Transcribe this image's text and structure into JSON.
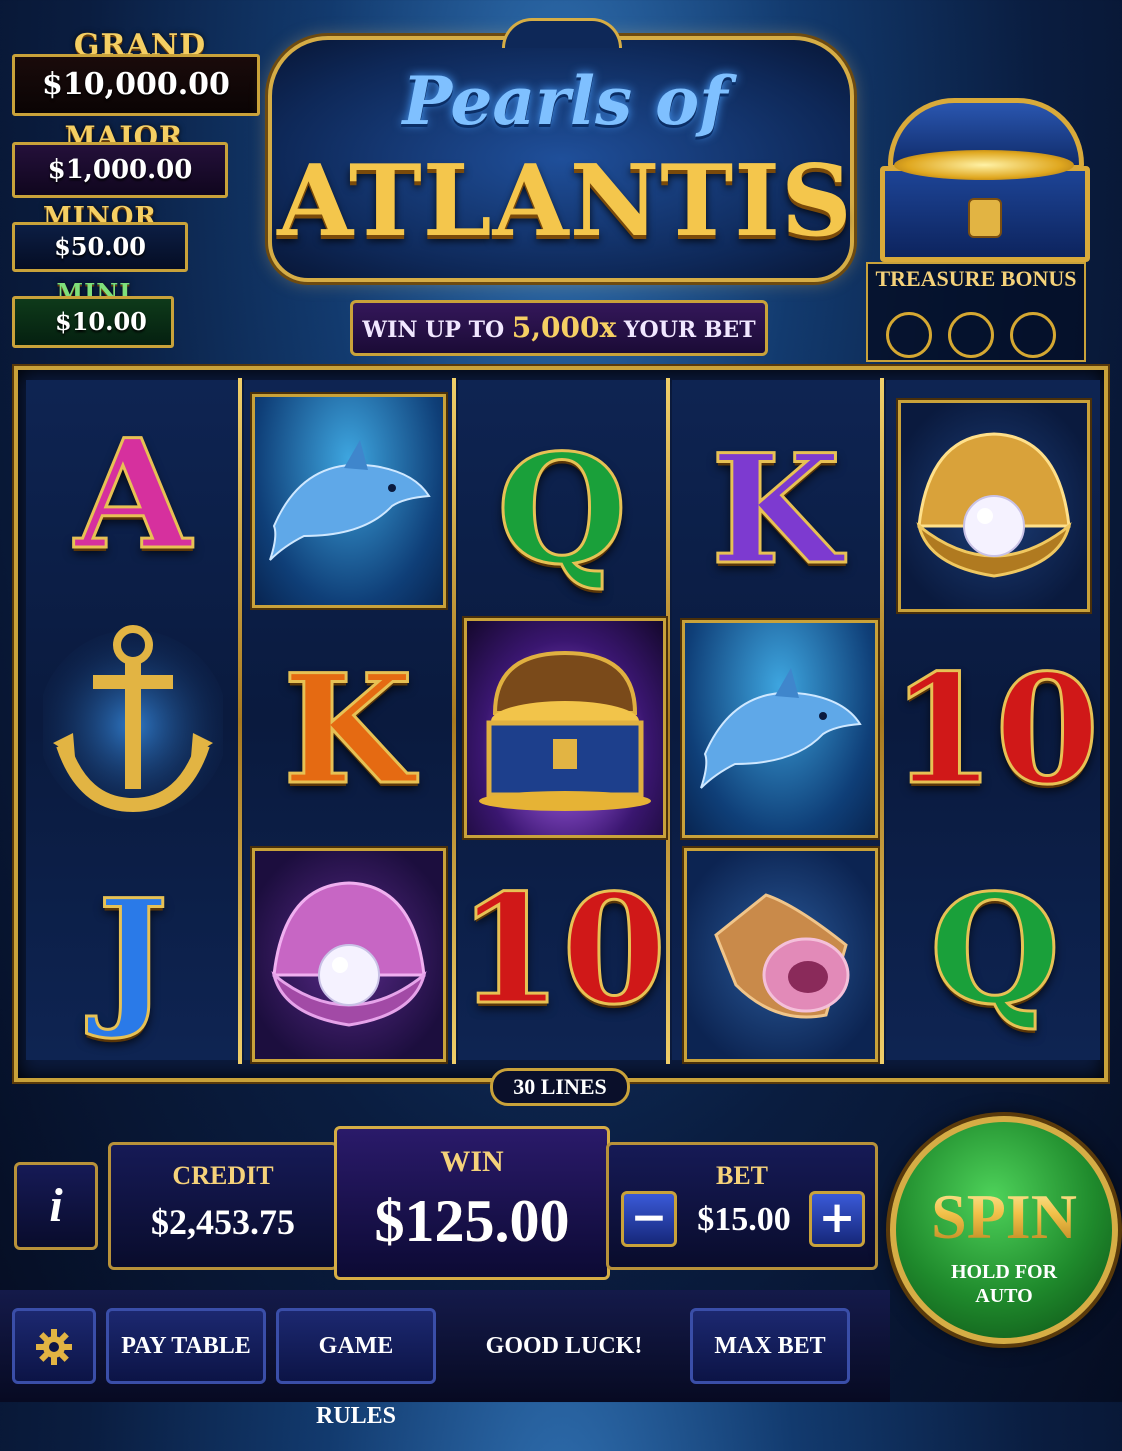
{
  "jackpots": [
    {
      "label": "GRAND",
      "value": "$10,000.00"
    },
    {
      "label": "MAJOR",
      "value": "$1,000.00"
    },
    {
      "label": "MINOR",
      "value": "$50.00"
    },
    {
      "label": "MINI",
      "value": "$10.00"
    }
  ],
  "title": {
    "line1": "Pearls of",
    "line2": "ATLANTIS"
  },
  "banner": {
    "pre": "WIN UP TO",
    "amount": "5,000x",
    "post": "YOUR BET"
  },
  "treasure_bonus": {
    "label": "TREASURE BONUS",
    "collected": 0,
    "slots": 3
  },
  "reels": [
    [
      "A",
      "anchor",
      "J"
    ],
    [
      "dolphin",
      "K",
      "pearl-shell-pink"
    ],
    [
      "Q",
      "treasure-chest",
      "10"
    ],
    [
      "K",
      "dolphin",
      "conch-shell"
    ],
    [
      "pearl-shell-gold",
      "10",
      "Q"
    ]
  ],
  "lines": "30 LINES",
  "controls": {
    "info": "i",
    "credit_label": "CREDIT",
    "credit_value": "$2,453.75",
    "win_label": "WIN",
    "win_value": "$125.00",
    "bet_label": "BET",
    "bet_value": "$15.00",
    "minus": "−",
    "plus": "+",
    "spin_label": "SPIN",
    "spin_sub": "HOLD FOR AUTO"
  },
  "bottom": {
    "settings_icon": "gear-icon",
    "pay_table": "PAY TABLE",
    "game_rules": "GAME RULES",
    "status": "GOOD LUCK!",
    "max_bet": "MAX BET"
  },
  "colors": {
    "gold": "#c9a23a",
    "A": "#d6309e",
    "J": "#2a7ae8",
    "Q": "#1aa03a",
    "K_purple": "#7d3ad0",
    "K_orange": "#e56a12",
    "ten": "#d01818",
    "spin": "#1f8a2c"
  }
}
